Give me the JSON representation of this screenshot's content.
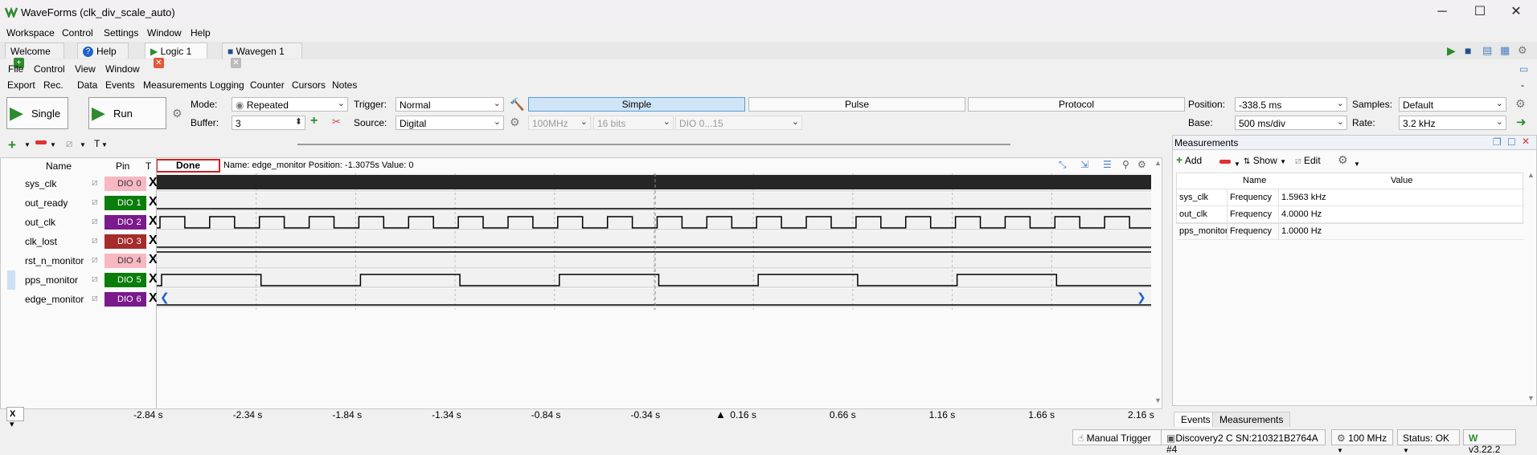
{
  "window": {
    "title": "WaveForms (clk_div_scale_auto)"
  },
  "main_menu": [
    "Workspace",
    "Control",
    "Settings",
    "Window",
    "Help"
  ],
  "tabs": [
    {
      "label": "Welcome"
    },
    {
      "label": "Help"
    },
    {
      "label": "Logic 1"
    },
    {
      "label": "Wavegen 1"
    }
  ],
  "logic_menu": [
    "File",
    "Control",
    "View",
    "Window"
  ],
  "logic_submenu": [
    "Export",
    "Rec.",
    "Data",
    "Events",
    "Measurements",
    "Logging",
    "Counter",
    "Cursors",
    "Notes"
  ],
  "acquisition": {
    "single_label": "Single",
    "run_label": "Run",
    "mode_label": "Mode:",
    "mode_value": "Repeated",
    "buffer_label": "Buffer:",
    "buffer_value": "3",
    "trigger_label": "Trigger:",
    "trigger_value": "Normal",
    "source_label": "Source:",
    "source_value": "Digital",
    "trigger_types": [
      "Simple",
      "Pulse",
      "Protocol"
    ],
    "rate_disabled": "100MHz",
    "bits_disabled": "16 bits",
    "dio_disabled": "DIO 0...15",
    "position_label": "Position:",
    "position_value": "-338.5 ms",
    "base_label": "Base:",
    "base_value": "500 ms/div",
    "samples_label": "Samples:",
    "samples_value": "Default",
    "rate_label": "Rate:",
    "rate_value": "3.2 kHz"
  },
  "signal_table": {
    "col_name": "Name",
    "col_pin": "Pin",
    "col_t": "T",
    "status": "Done",
    "info": "Name: edge_monitor  Position: -1.3075s  Value: 0",
    "signals": [
      {
        "name": "sys_clk",
        "pin": "DIO",
        "pin_num": "0",
        "color": "#f7b8c2",
        "trig": "X"
      },
      {
        "name": "out_ready",
        "pin": "DIO",
        "pin_num": "1",
        "color": "#0a7d0a",
        "trig": "X"
      },
      {
        "name": "out_clk",
        "pin": "DIO",
        "pin_num": "2",
        "color": "#7a1a8c",
        "trig": "X"
      },
      {
        "name": "clk_lost",
        "pin": "DIO",
        "pin_num": "3",
        "color": "#a62b2b",
        "trig": "X"
      },
      {
        "name": "rst_n_monitor",
        "pin": "DIO",
        "pin_num": "4",
        "color": "#f7b8c2",
        "trig": "X"
      },
      {
        "name": "pps_monitor",
        "pin": "DIO",
        "pin_num": "5",
        "color": "#0a7d0a",
        "trig": "X"
      },
      {
        "name": "edge_monitor",
        "pin": "DIO",
        "pin_num": "6",
        "color": "#7a1a8c",
        "trig": "X"
      }
    ]
  },
  "time_axis": [
    "-2.84 s",
    "-2.34 s",
    "-1.84 s",
    "-1.34 s",
    "-0.84 s",
    "-0.34 s",
    "0.16 s",
    "0.66 s",
    "1.16 s",
    "1.66 s",
    "2.16 s"
  ],
  "measurements": {
    "title": "Measurements",
    "add_label": "Add",
    "show_label": "Show",
    "edit_label": "Edit",
    "col_name": "Name",
    "col_value": "Value",
    "rows": [
      {
        "signal": "sys_clk",
        "type": "Frequency",
        "value": "1.5963 kHz"
      },
      {
        "signal": "out_clk",
        "type": "Frequency",
        "value": "4.0000 Hz"
      },
      {
        "signal": "pps_monitor",
        "type": "Frequency",
        "value": "1.0000 Hz"
      }
    ],
    "bottom_tabs": [
      "Events",
      "Measurements"
    ]
  },
  "status_bar": {
    "manual_trigger": "Manual Trigger",
    "device": "Discovery2 C SN:210321B2764A #4",
    "clock": "100 MHz",
    "status": "Status: OK",
    "version": "v3.22.2"
  },
  "colors": {
    "accent": "#2e8b2e",
    "selected_trigger": "#cfe5f7",
    "done_border": "#d02020"
  }
}
